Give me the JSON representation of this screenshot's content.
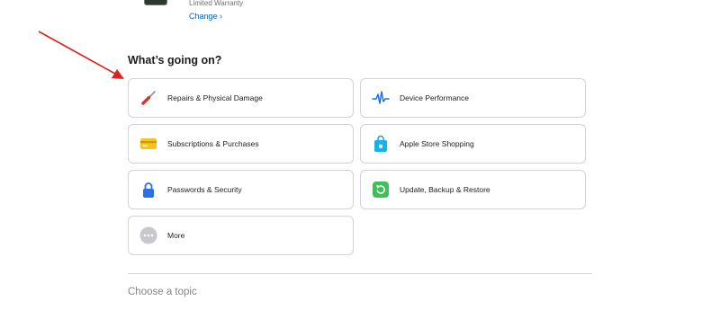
{
  "header": {
    "warranty_text": "Limited Warranty",
    "change_label": "Change ›"
  },
  "section_title": "What’s going on?",
  "topics": [
    {
      "label": "Repairs & Physical Damage",
      "icon": "screwdriver-icon"
    },
    {
      "label": "Device Performance",
      "icon": "pulse-icon"
    },
    {
      "label": "Subscriptions & Purchases",
      "icon": "credit-card-icon"
    },
    {
      "label": "Apple Store Shopping",
      "icon": "shopping-bag-icon"
    },
    {
      "label": "Passwords & Security",
      "icon": "lock-icon"
    },
    {
      "label": "Update, Backup & Restore",
      "icon": "restore-icon"
    },
    {
      "label": "More",
      "icon": "more-dots-icon"
    }
  ],
  "choose_topic_label": "Choose a topic",
  "colors": {
    "link": "#0066cc",
    "annotation_arrow": "#e0201b",
    "tile_border": "#d2d2d7"
  }
}
